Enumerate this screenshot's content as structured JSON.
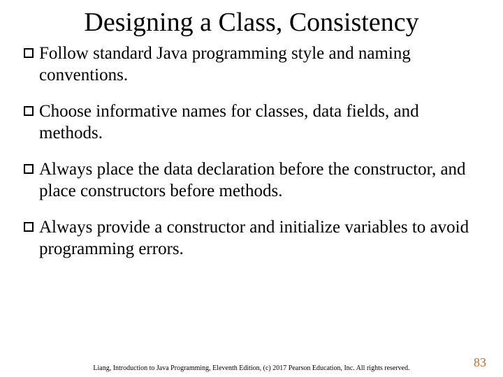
{
  "title": "Designing a Class, Consistency",
  "bullets": [
    "Follow standard Java programming style and naming conventions.",
    "Choose informative names for classes, data fields, and methods.",
    "Always place the data declaration before the constructor, and place constructors before methods.",
    "Always provide a constructor and initialize variables to avoid programming errors."
  ],
  "footer": "Liang, Introduction to Java Programming, Eleventh Edition, (c) 2017 Pearson Education, Inc. All rights reserved.",
  "page_number": "83"
}
